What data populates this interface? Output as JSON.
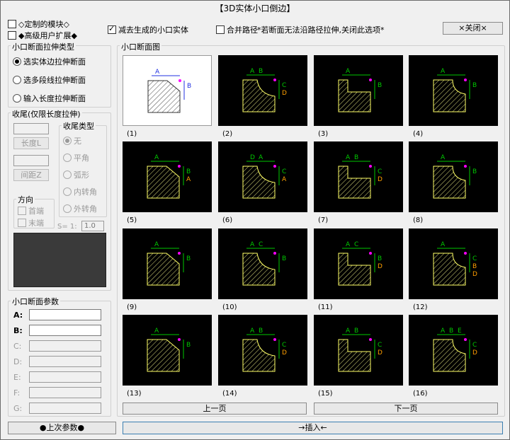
{
  "window": {
    "title": "【3D实体小口倒边】"
  },
  "top": {
    "custom_module": "◇定制的模块◇",
    "advanced_ext": "◆高级用户扩展◆",
    "subtract_solid": "减去生成的小口实体",
    "merge_path": "合并路径",
    "merge_note": "*若断面无法沿路径拉伸,关闭此选项*",
    "close_label": "×关闭×"
  },
  "stretch_group": {
    "title": "小口断面拉伸类型",
    "options": [
      "选实体边拉伸断面",
      "选多段线拉伸断面",
      "输入长度拉伸断面"
    ]
  },
  "tail_group": {
    "title": "收尾(仅限长度拉伸)",
    "length_btn": "长度L",
    "spacing_btn": "间距Z",
    "type_title": "收尾类型",
    "types": [
      "无",
      "平角",
      "弧形",
      "内转角",
      "外转角"
    ],
    "direction_title": "方向",
    "directions": [
      "首端",
      "末端"
    ],
    "scale_label": "S= 1:",
    "scale_value": "1.0"
  },
  "params_group": {
    "title": "小口断面参数",
    "labels": [
      "A:",
      "B:",
      "C:",
      "D:",
      "E:",
      "F:",
      "G:"
    ]
  },
  "section_group": {
    "title": "小口断面图",
    "captions": [
      "(1)",
      "(2)",
      "(3)",
      "(4)",
      "(5)",
      "(6)",
      "(7)",
      "(8)",
      "(9)",
      "(10)",
      "(11)",
      "(12)",
      "(13)",
      "(14)",
      "(15)",
      "(16)"
    ],
    "dims": [
      {
        "top": [
          "A"
        ],
        "side": [
          "B"
        ]
      },
      {
        "top": [
          "A",
          "B"
        ],
        "side": [
          "C",
          "D"
        ]
      },
      {
        "top": [
          "A"
        ],
        "side": [
          "B"
        ]
      },
      {
        "top": [
          "A"
        ],
        "side": [
          "B"
        ]
      },
      {
        "top": [
          "A"
        ],
        "side": [
          "B",
          "A"
        ]
      },
      {
        "top": [
          "D",
          "A"
        ],
        "side": [
          "C",
          "A"
        ]
      },
      {
        "top": [
          "A",
          "B"
        ],
        "side": [
          "C",
          "D"
        ]
      },
      {
        "top": [
          "A"
        ],
        "side": [
          "B"
        ]
      },
      {
        "top": [
          "A"
        ],
        "side": [
          "B"
        ]
      },
      {
        "top": [
          "A",
          "C"
        ],
        "side": [
          "B"
        ]
      },
      {
        "top": [
          "A",
          "C"
        ],
        "side": [
          "B",
          "D"
        ]
      },
      {
        "top": [
          "A"
        ],
        "side": [
          "C",
          "B",
          "D"
        ]
      },
      {
        "top": [
          "A"
        ],
        "side": [
          "B"
        ]
      },
      {
        "top": [
          "A",
          "B"
        ],
        "side": [
          "C",
          "D"
        ]
      },
      {
        "top": [
          "A",
          "B"
        ],
        "side": [
          "C",
          "D"
        ]
      },
      {
        "top": [
          "A",
          "B",
          "E"
        ],
        "side": [
          "C",
          "D"
        ]
      }
    ],
    "prev_page": "上一页",
    "next_page": "下一页"
  },
  "bottom": {
    "last_params": "●上次参数●",
    "insert": "→插入←"
  },
  "colors": {
    "dim": "#00c800",
    "dim_first": "#2030e0",
    "side_dim": "#ffa000",
    "hatch": "#ffff66",
    "marker": "#ff00ff"
  }
}
